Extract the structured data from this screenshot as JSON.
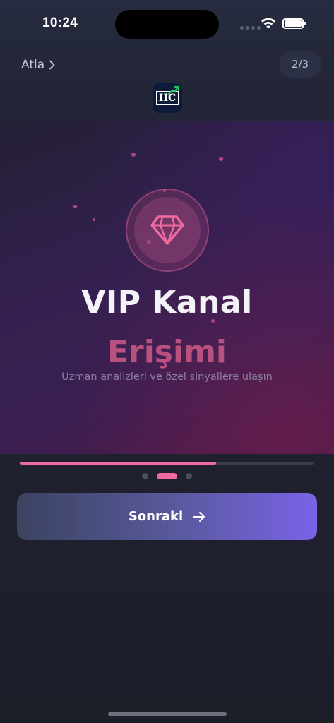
{
  "status_bar": {
    "time": "10:24"
  },
  "header": {
    "skip_label": "Atla",
    "page_indicator": "2/3",
    "logo_text": "HC"
  },
  "hero": {
    "icon": "diamond-icon",
    "title": "VIP Kanal",
    "subtitle": "Erişimi",
    "description": "Uzman analizleri ve özel sinyallere ulaşın"
  },
  "progress": {
    "value": 0.667
  },
  "pagination": {
    "total": 3,
    "current": 2
  },
  "actions": {
    "next_label": "Sonraki"
  },
  "colors": {
    "accent_pink": "#f06aa0",
    "button_gradient_end": "#7b62e8",
    "subtitle_pink": "#b9517f"
  }
}
